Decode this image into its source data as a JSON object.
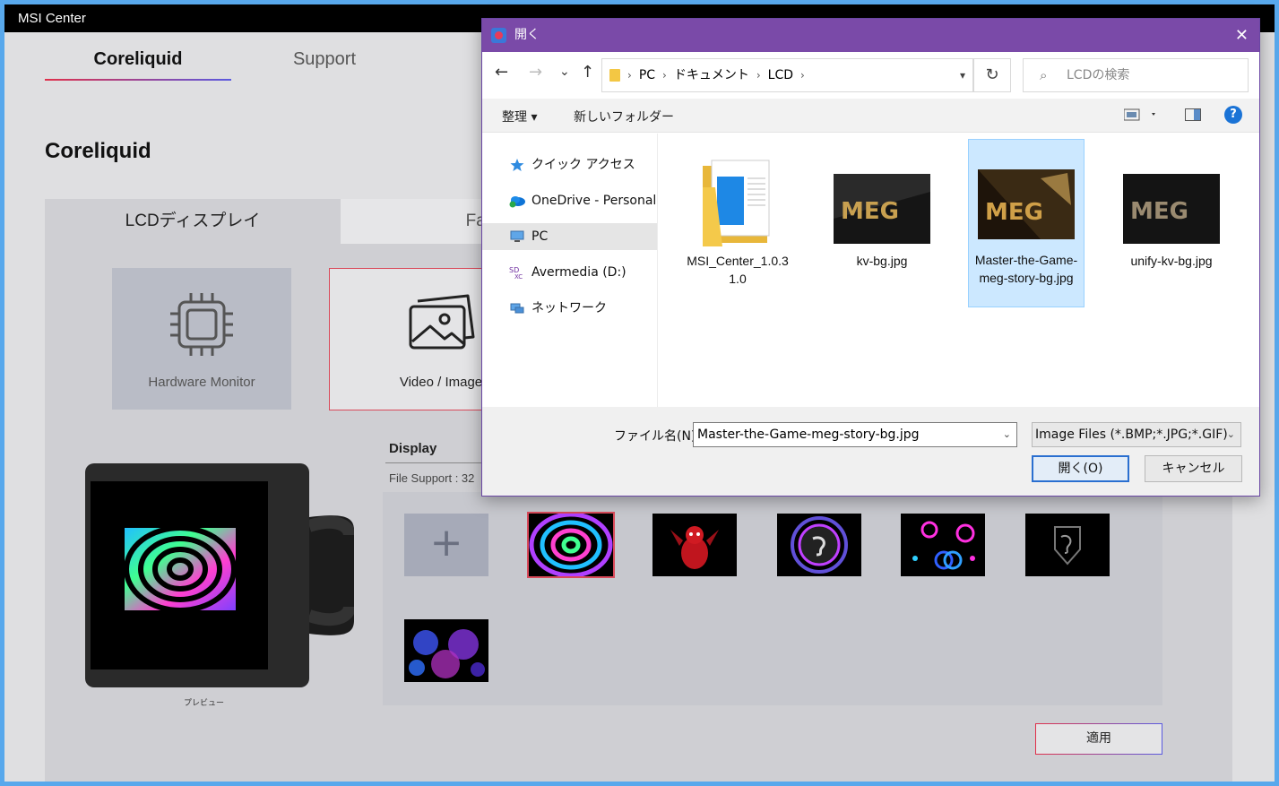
{
  "msi": {
    "title": "MSI Center",
    "tabs": [
      "Coreliquid",
      "Support"
    ],
    "heading": "Coreliquid",
    "subtabs": [
      "LCDディスプレイ",
      "Fan"
    ],
    "modes": [
      "Hardware Monitor",
      "Video / Image"
    ],
    "preview_caption": "プレビュー",
    "display_label": "Display",
    "file_support": "File Support : 32",
    "gallery_add": "+",
    "apply": "適用"
  },
  "dialog": {
    "title": "開く",
    "close": "✕",
    "nav": {
      "back": "←",
      "forward": "→",
      "recent": "⌄",
      "up": "↑",
      "refresh": "↻"
    },
    "breadcrumb": [
      "PC",
      "ドキュメント",
      "LCD"
    ],
    "search_placeholder": "LCDの検索",
    "toolbar": {
      "organize": "整理 ▾",
      "new_folder": "新しいフォルダー",
      "help": "?"
    },
    "nav_items": [
      "クイック アクセス",
      "OneDrive - Personal",
      "PC",
      "Avermedia (D:)",
      "ネットワーク"
    ],
    "files": [
      {
        "name": "MSI_Center_1.0.31.0",
        "kind": "folder"
      },
      {
        "name": "kv-bg.jpg",
        "kind": "image"
      },
      {
        "name": "Master-the-Game-meg-story-bg.jpg",
        "kind": "image"
      },
      {
        "name": "unify-kv-bg.jpg",
        "kind": "image"
      }
    ],
    "filename_label": "ファイル名(N):",
    "filename_value": "Master-the-Game-meg-story-bg.jpg",
    "filetype_value": "Image Files (*.BMP;*.JPG;*.GIF)",
    "open_button": "開く(O)",
    "cancel_button": "キャンセル"
  },
  "colors": {
    "accent_red": "#d94a5a",
    "accent_blue": "#5a5ae0",
    "dialog_title": "#7a4aa8",
    "selection": "#cce8ff"
  }
}
